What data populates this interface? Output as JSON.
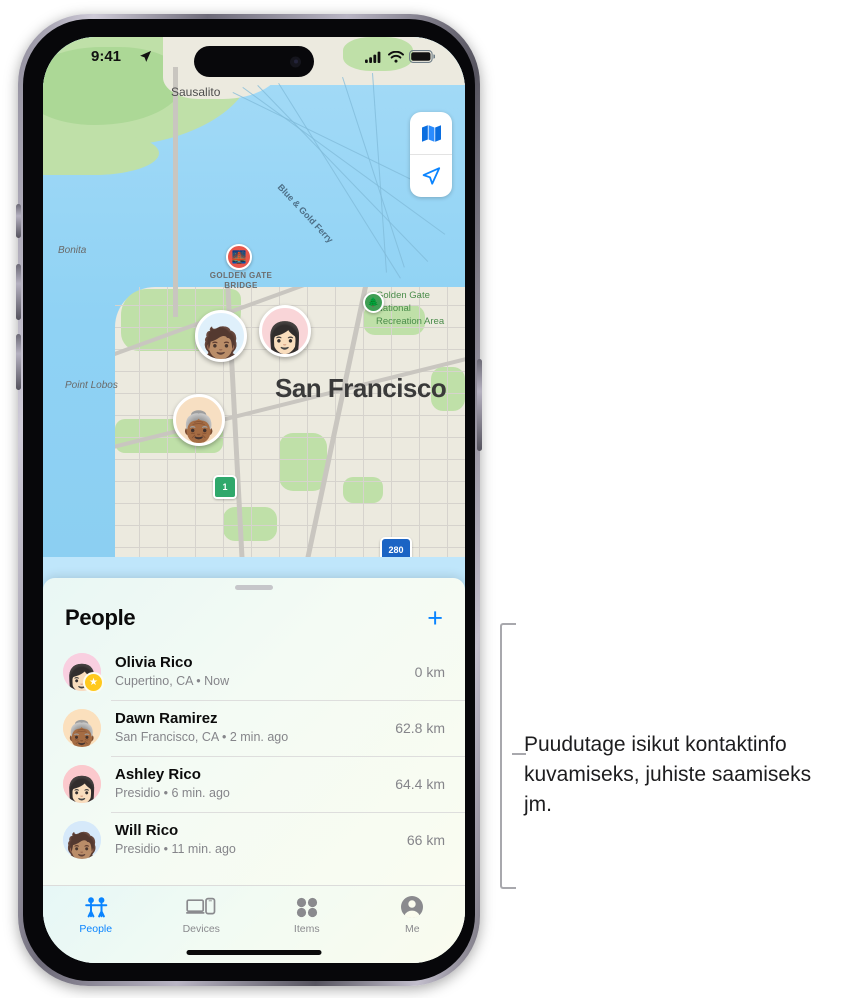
{
  "status_bar": {
    "time": "9:41",
    "location_icon": "location-arrow-icon",
    "cellular_icon": "cellular-bars-icon",
    "wifi_icon": "wifi-icon",
    "battery_icon": "battery-icon"
  },
  "map": {
    "controls": [
      {
        "name": "map-type-button",
        "icon": "folded-map-icon"
      },
      {
        "name": "locate-me-button",
        "icon": "location-arrow-icon"
      }
    ],
    "labels": [
      {
        "text": "Sausalito",
        "style": "plain"
      },
      {
        "text": "Bonita",
        "style": "italic"
      },
      {
        "text": "Point Lobos",
        "style": "italic"
      },
      {
        "text": "Blue & Gold Ferry",
        "style": "ferry"
      },
      {
        "text": "GOLDEN GATE",
        "style": "caps"
      },
      {
        "text": "BRIDGE",
        "style": "caps"
      },
      {
        "text": "Golden Gate",
        "style": "park"
      },
      {
        "text": "National",
        "style": "park"
      },
      {
        "text": "Recreation Area",
        "style": "park"
      },
      {
        "text": "San Francisco",
        "style": "city"
      }
    ],
    "city_label": "San Francisco",
    "sausalito_label": "Sausalito",
    "bonita_label": "Bonita",
    "point_lobos_label": "Point Lobos",
    "ferry_label": "Blue & Gold Ferry",
    "bridge_label_line1": "GOLDEN GATE",
    "bridge_label_line2": "BRIDGE",
    "park_label_line1": "Golden Gate",
    "park_label_line2": "National",
    "park_label_line3": "Recreation Area",
    "shields": [
      {
        "name": "route-1-shield",
        "text": "1",
        "color": "#2fa86b"
      },
      {
        "name": "interstate-280-shield",
        "text": "280",
        "color": "#1b64c4"
      }
    ],
    "route_1": "1",
    "interstate_280": "280",
    "pins": [
      {
        "name": "map-pin-will-rico",
        "emoji": "🧑🏽",
        "ring": "#dff0fb"
      },
      {
        "name": "map-pin-ashley-rico",
        "emoji": "👩🏻",
        "ring": "#f9d5d8"
      },
      {
        "name": "map-pin-dawn-ramirez",
        "emoji": "👵🏾",
        "ring": "#f7dfc2"
      }
    ],
    "poi_bridge_icon": "bridge-icon",
    "poi_park_icon": "park-tree-icon"
  },
  "sheet": {
    "title": "People",
    "add_label": "+",
    "people": [
      {
        "name": "Olivia Rico",
        "detail": "Cupertino, CA • Now",
        "distance": "0 km",
        "avatar_bg": "#f9cfe0",
        "avatar_emoji": "👩🏻",
        "favorite": true,
        "star": "★"
      },
      {
        "name": "Dawn Ramirez",
        "detail": "San Francisco, CA • 2 min. ago",
        "distance": "62.8 km",
        "avatar_bg": "#fbe0bd",
        "avatar_emoji": "👵🏾",
        "favorite": false,
        "star": ""
      },
      {
        "name": "Ashley Rico",
        "detail": "Presidio • 6 min. ago",
        "distance": "64.4 km",
        "avatar_bg": "#fbc9cd",
        "avatar_emoji": "👩🏻",
        "favorite": false,
        "star": ""
      },
      {
        "name": "Will Rico",
        "detail": "Presidio • 11 min. ago",
        "distance": "66 km",
        "avatar_bg": "#d6e9fa",
        "avatar_emoji": "🧑🏽",
        "favorite": false,
        "star": ""
      }
    ]
  },
  "tab_bar": {
    "tabs": [
      {
        "label": "People",
        "icon": "two-people-icon",
        "active": true
      },
      {
        "label": "Devices",
        "icon": "laptop-phone-icon",
        "active": false
      },
      {
        "label": "Items",
        "icon": "four-dots-icon",
        "active": false
      },
      {
        "label": "Me",
        "icon": "person-circle-icon",
        "active": false
      }
    ]
  },
  "callout": {
    "text": "Puudutage isikut kontaktinfo kuvamiseks, juhiste saamiseks jm."
  },
  "colors": {
    "accent": "#0a84ff",
    "star": "#ffc91e",
    "water": "#8fd2f4",
    "land": "#eceadf",
    "park_green": "#bfe0a8",
    "muted_text": "#85858a",
    "bracket": "#a8a8ad"
  }
}
